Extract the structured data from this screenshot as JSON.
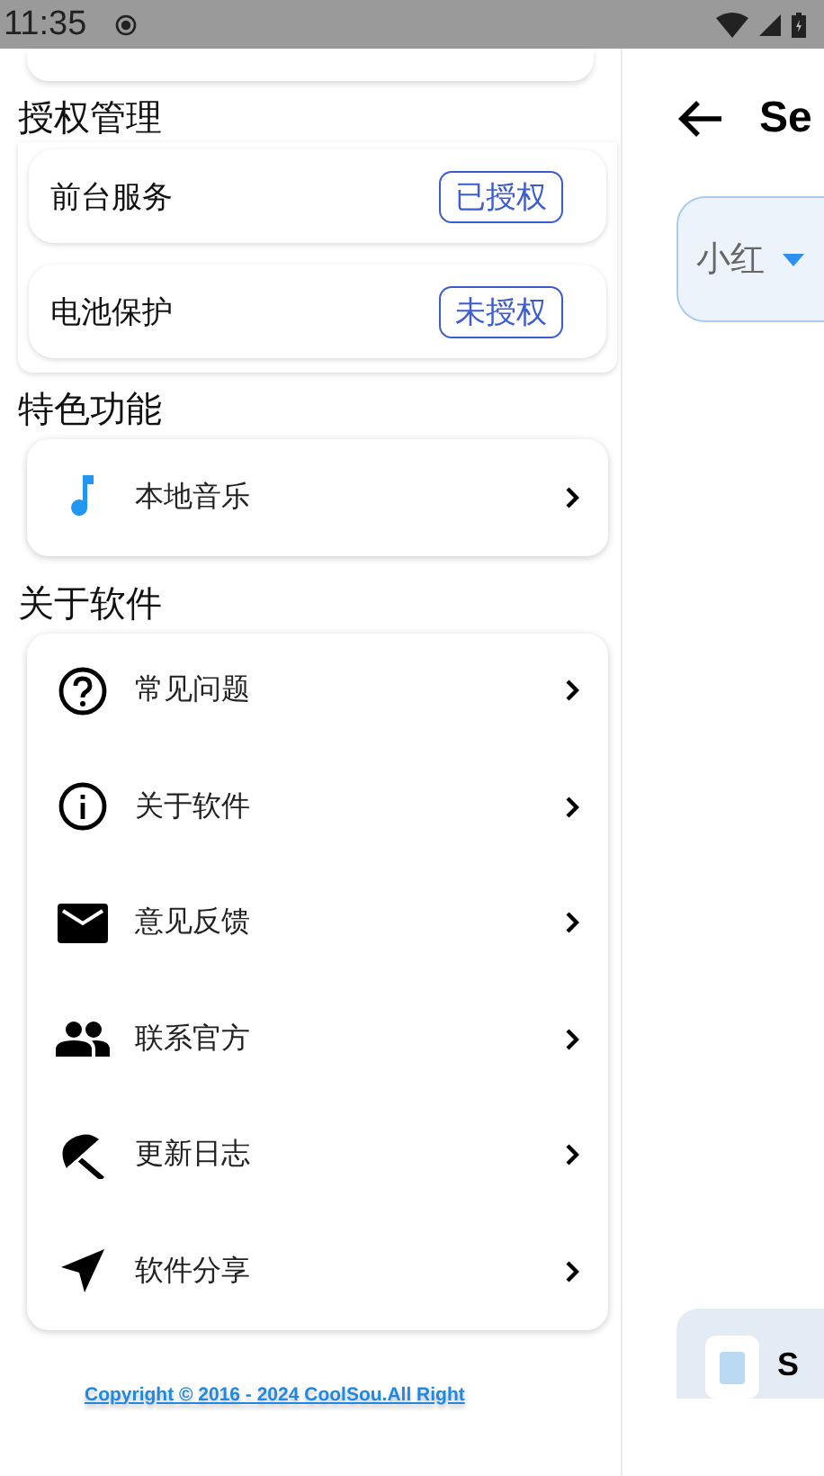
{
  "status_bar": {
    "time": "11:35"
  },
  "sections": [
    {
      "title": "授权管理",
      "kind": "permissions",
      "items": [
        {
          "label": "前台服务",
          "badge": "已授权"
        },
        {
          "label": "电池保护",
          "badge": "未授权"
        }
      ]
    },
    {
      "title": "特色功能",
      "kind": "menu",
      "items": [
        {
          "label": "本地音乐",
          "kind": "music"
        }
      ]
    },
    {
      "title": "关于软件",
      "kind": "menu",
      "items": [
        {
          "label": "常见问题",
          "kind": "help"
        },
        {
          "label": "关于软件",
          "kind": "info"
        },
        {
          "label": "意见反馈",
          "kind": "mail"
        },
        {
          "label": "联系官方",
          "kind": "people"
        },
        {
          "label": "更新日志",
          "kind": "umbrella"
        },
        {
          "label": "软件分享",
          "kind": "send"
        }
      ]
    }
  ],
  "copyright": "Copyright © 2016 - 2024 CoolSou.All Right",
  "right_panel": {
    "title": "Se",
    "dropdown": "小红",
    "card_text": "S"
  }
}
